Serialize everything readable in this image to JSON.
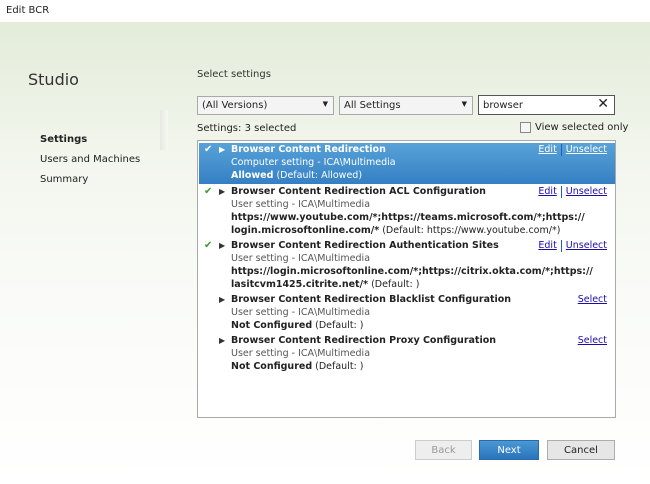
{
  "window": {
    "title": "Edit BCR"
  },
  "sidebar": {
    "brand": "Studio",
    "items": [
      {
        "label": "Settings",
        "active": true
      },
      {
        "label": "Users and Machines"
      },
      {
        "label": "Summary"
      }
    ]
  },
  "main": {
    "heading": "Select settings",
    "filters": {
      "version": "(All Versions)",
      "category": "All Settings",
      "search_value": "browser"
    },
    "selected_count": "Settings: 3 selected",
    "view_selected_only": "View selected only",
    "settings": [
      {
        "title": "Browser Content Redirection",
        "scope": "Computer setting - ICA\\Multimedia",
        "value": "Allowed",
        "default": " (Default: Allowed)",
        "selected": true,
        "highlighted": true,
        "edit": "Edit",
        "toggle": "Unselect"
      },
      {
        "title": "Browser Content Redirection ACL Configuration",
        "scope": "User setting - ICA\\Multimedia",
        "value": "https://www.youtube.com/*;https://teams.microsoft.com/*;https://",
        "value2": "login.microsoftonline.com/*",
        "default": " (Default: https://www.youtube.com/*)",
        "selected": true,
        "edit": "Edit",
        "toggle": "Unselect"
      },
      {
        "title": "Browser Content Redirection Authentication Sites",
        "scope": "User setting - ICA\\Multimedia",
        "value": "https://login.microsoftonline.com/*;https://citrix.okta.com/*;https://",
        "value2": "lasitcvm1425.citrite.net/*",
        "default": " (Default: )",
        "selected": true,
        "edit": "Edit",
        "toggle": "Unselect"
      },
      {
        "title": "Browser Content Redirection Blacklist Configuration",
        "scope": "User setting - ICA\\Multimedia",
        "value": "Not Configured",
        "default": " (Default: )",
        "selected": false,
        "toggle": "Select"
      },
      {
        "title": "Browser Content Redirection Proxy Configuration",
        "scope": "User setting - ICA\\Multimedia",
        "value": "Not Configured",
        "default": " (Default: )",
        "selected": false,
        "toggle": "Select"
      }
    ]
  },
  "footer": {
    "back": "Back",
    "next": "Next",
    "cancel": "Cancel"
  },
  "colors": {
    "selection": "#3580c4",
    "check": "#3a9a2a",
    "link": "#1a0dab"
  }
}
